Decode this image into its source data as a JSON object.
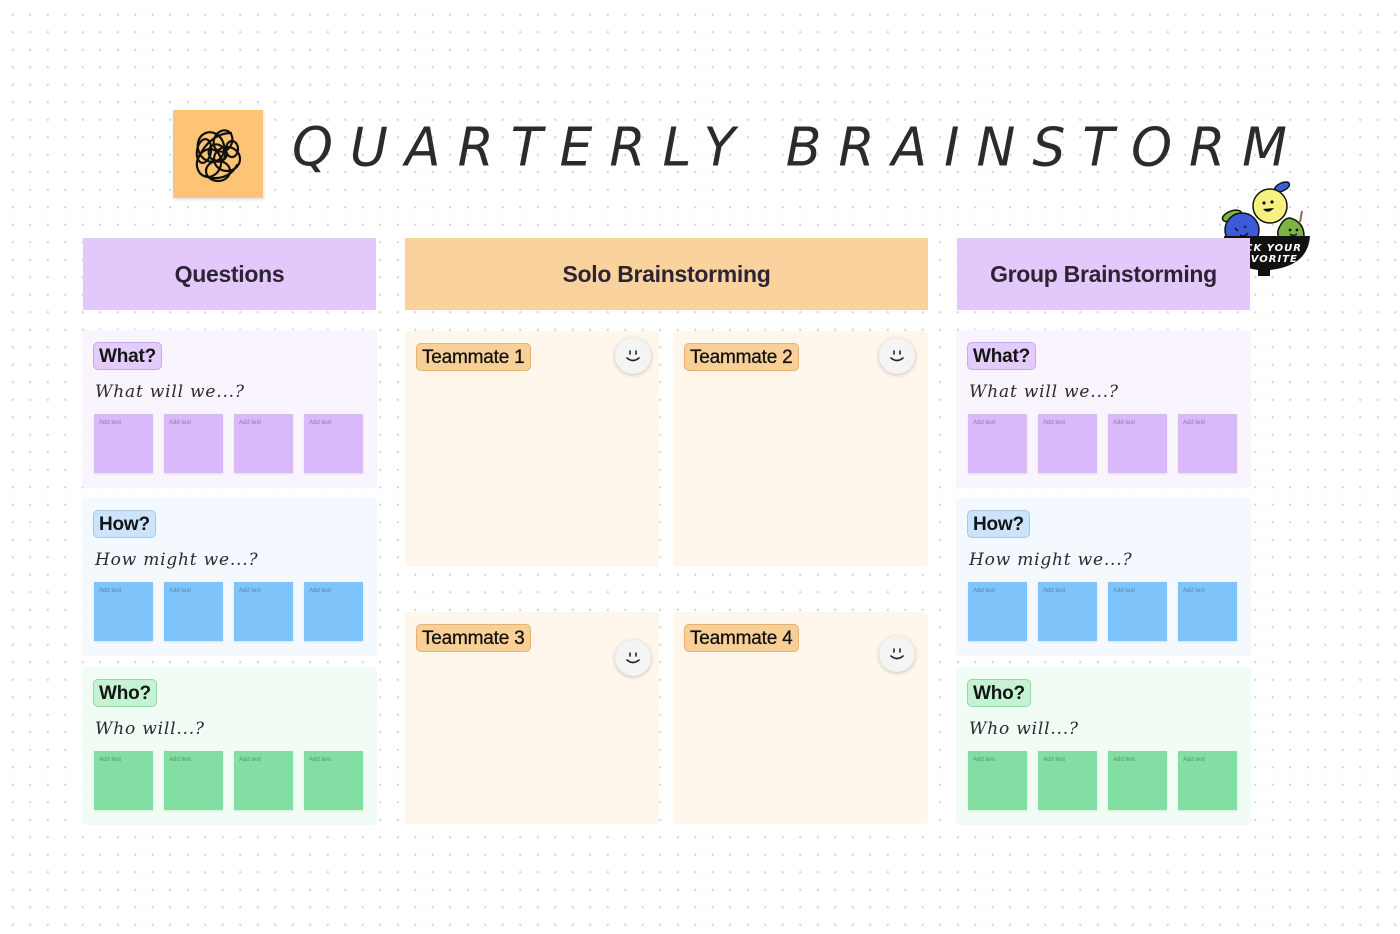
{
  "board": {
    "title": "QUARTERLY BRAINSTORM",
    "logo_icon": "scribble-icon",
    "sticker": {
      "icon": "fruit-bowl-sticker",
      "line1": "PICK YOUR",
      "line2": "FAVORITE"
    }
  },
  "columns": {
    "questions": "Questions",
    "solo": "Solo Brainstorming",
    "group": "Group Brainstorming"
  },
  "question_cards": [
    {
      "tag": "What?",
      "prompt": "What will we...?",
      "stickies": [
        "Add text",
        "Add text",
        "Add text",
        "Add text"
      ]
    },
    {
      "tag": "How?",
      "prompt": "How might we...?",
      "stickies": [
        "Add text",
        "Add text",
        "Add text",
        "Add text"
      ]
    },
    {
      "tag": "Who?",
      "prompt": "Who will...?",
      "stickies": [
        "Add text",
        "Add text",
        "Add text",
        "Add text"
      ]
    }
  ],
  "group_cards": [
    {
      "tag": "What?",
      "prompt": "What will we...?",
      "stickies": [
        "Add text",
        "Add text",
        "Add text",
        "Add text"
      ]
    },
    {
      "tag": "How?",
      "prompt": "How might we...?",
      "stickies": [
        "Add text",
        "Add text",
        "Add text",
        "Add text"
      ]
    },
    {
      "tag": "Who?",
      "prompt": "Who will...?",
      "stickies": [
        "Add text",
        "Add text",
        "Add text",
        "Add text"
      ]
    }
  ],
  "teammates": [
    {
      "label": "Teammate 1",
      "icon": "smiley-icon"
    },
    {
      "label": "Teammate 2",
      "icon": "smiley-icon"
    },
    {
      "label": "Teammate 3",
      "icon": "smiley-icon"
    },
    {
      "label": "Teammate 4",
      "icon": "smiley-icon"
    }
  ],
  "colors": {
    "header_purple": "#e3c9fb",
    "header_orange": "#f9d29d",
    "sticky_purple": "#d9b8fb",
    "sticky_blue": "#7fc5fc",
    "sticky_green": "#82dea2",
    "logo_orange": "#fcc474"
  }
}
